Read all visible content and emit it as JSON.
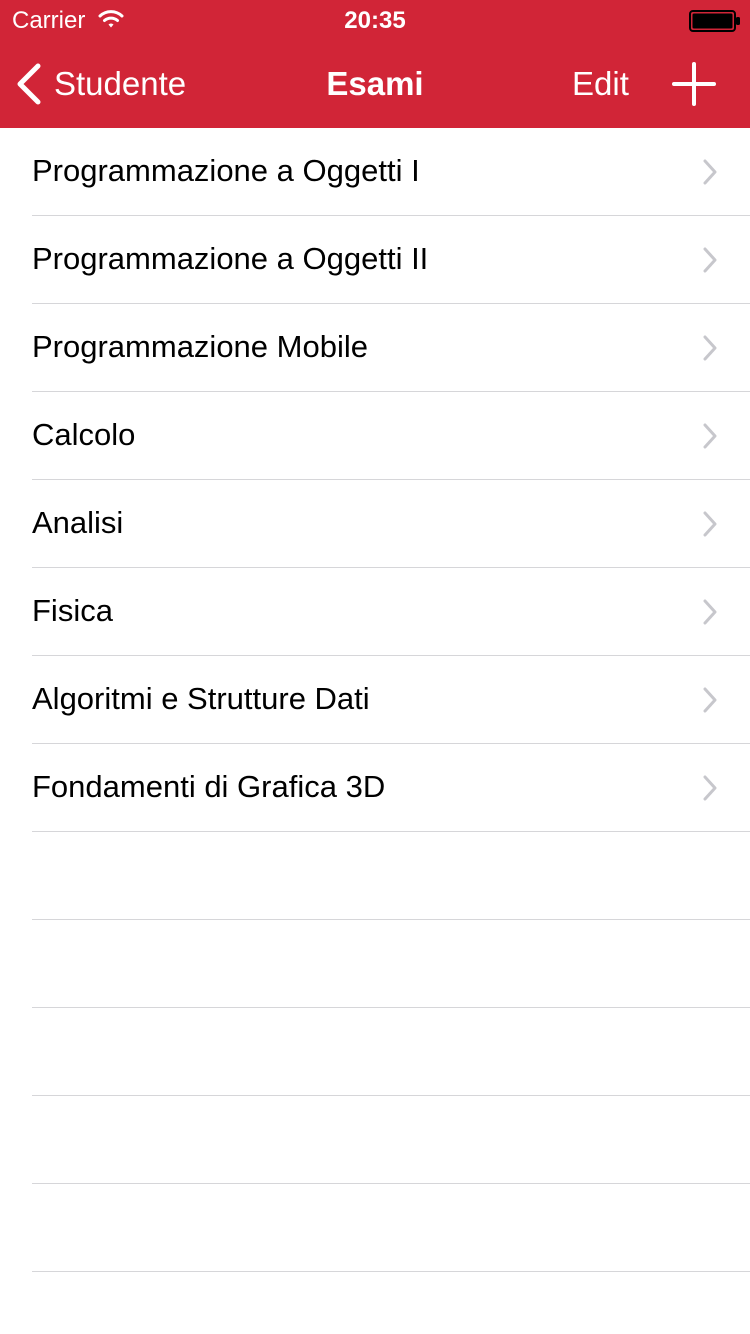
{
  "status_bar": {
    "carrier": "Carrier",
    "time": "20:35"
  },
  "nav": {
    "back_label": "Studente",
    "title": "Esami",
    "edit_label": "Edit",
    "add_icon": "plus-icon"
  },
  "colors": {
    "accent": "#d12537",
    "separator": "#d6d6d9",
    "disclosure": "#c7c7cc"
  },
  "exams": [
    {
      "label": "Programmazione a Oggetti I"
    },
    {
      "label": "Programmazione a Oggetti II"
    },
    {
      "label": "Programmazione Mobile"
    },
    {
      "label": "Calcolo"
    },
    {
      "label": "Analisi"
    },
    {
      "label": "Fisica"
    },
    {
      "label": "Algoritmi e Strutture Dati"
    },
    {
      "label": "Fondamenti di Grafica 3D"
    }
  ]
}
